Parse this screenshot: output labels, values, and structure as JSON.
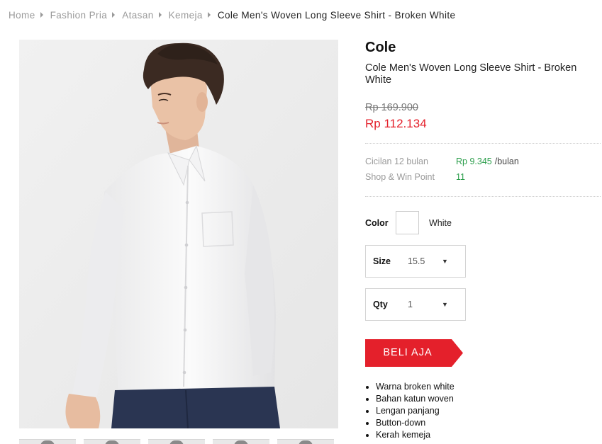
{
  "breadcrumb": {
    "items": [
      "Home",
      "Fashion Pria",
      "Atasan",
      "Kemeja"
    ],
    "current": "Cole Men's Woven Long Sleeve Shirt - Broken White"
  },
  "product": {
    "brand": "Cole",
    "title": "Cole Men's Woven Long Sleeve Shirt - Broken White",
    "price_original": "Rp 169.900",
    "price_discounted": "Rp 112.134"
  },
  "installment": {
    "label": "Cicilan 12 bulan",
    "value": "Rp 9.345",
    "unit": "/bulan"
  },
  "points": {
    "label": "Shop & Win Point",
    "value": "11"
  },
  "color": {
    "label": "Color",
    "name": "White",
    "swatch": "#ffffff"
  },
  "size": {
    "label": "Size",
    "value": "15.5"
  },
  "qty": {
    "label": "Qty",
    "value": "1"
  },
  "buy_label": "BELI AJA",
  "features": [
    "Warna broken white",
    "Bahan katun woven",
    "Lengan panjang",
    "Button-down",
    "Kerah kemeja"
  ],
  "colors": {
    "accent_red": "#e4202b",
    "installment_green": "#2a9d4a"
  }
}
